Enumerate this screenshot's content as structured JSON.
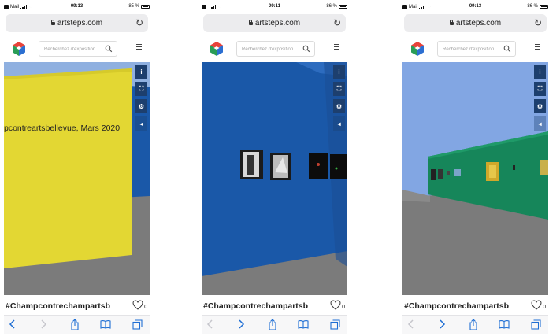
{
  "colors": {
    "accent": "#1e6ed4",
    "control_bg": "#1d3f6e",
    "toolbar_bg": "#f7f7f8"
  },
  "screens": [
    {
      "status": {
        "carrier": "Mail",
        "time": "09:13",
        "battery": "85 %"
      },
      "browser": {
        "url": "artsteps.com"
      },
      "search": {
        "placeholder": "Recherchez d'exposition"
      },
      "scene": {
        "wall_text": "pcontreartsbellevue, Mars 2020"
      },
      "controls": {
        "info": "i",
        "fullscreen": "⛶",
        "settings": "⚙",
        "sound": "◂"
      },
      "footer": {
        "title": "#Champcontrechampartsb",
        "likes": "0"
      },
      "toolbar": {
        "back_enabled": true,
        "forward_enabled": false
      }
    },
    {
      "status": {
        "carrier": "",
        "time": "09:11",
        "battery": "86 %"
      },
      "browser": {
        "url": "artsteps.com"
      },
      "search": {
        "placeholder": "Recherchez d'exposition"
      },
      "scene": {
        "wall_text": ""
      },
      "controls": {
        "info": "i",
        "fullscreen": "⛶",
        "settings": "⚙",
        "sound": "◂"
      },
      "footer": {
        "title": "#Champcontrechampartsb",
        "likes": "0"
      },
      "toolbar": {
        "back_enabled": false,
        "forward_enabled": true
      }
    },
    {
      "status": {
        "carrier": "Mail",
        "time": "09:13",
        "battery": "86 %"
      },
      "browser": {
        "url": "artsteps.com"
      },
      "search": {
        "placeholder": "Recherchez d'exposition"
      },
      "scene": {
        "wall_text": ""
      },
      "controls": {
        "info": "i",
        "fullscreen": "⛶",
        "settings": "⚙",
        "sound": "◂"
      },
      "footer": {
        "title": "#Champcontrechampartsb",
        "likes": "0"
      },
      "toolbar": {
        "back_enabled": false,
        "forward_enabled": true
      }
    }
  ]
}
